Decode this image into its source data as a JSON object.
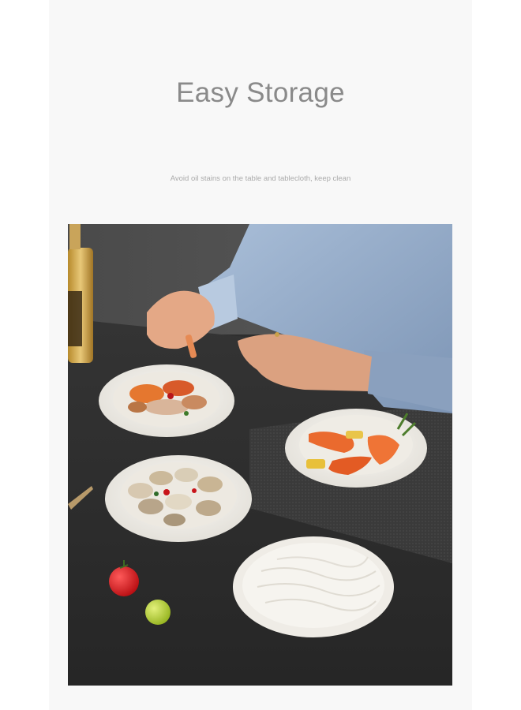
{
  "heading": {
    "title": "Easy Storage",
    "subtitle": "Avoid oil stains on the table and tablecloth, keep clean"
  },
  "photo": {
    "subject": "plates-with-seafood-on-dark-table",
    "colors": {
      "table": "#2e2e2e",
      "shirt": "#8fa6c4",
      "plate": "#f3f1ec",
      "shrimp": "#e86a2e",
      "tomato": "#d2161c",
      "grape": "#b6d23a"
    }
  }
}
